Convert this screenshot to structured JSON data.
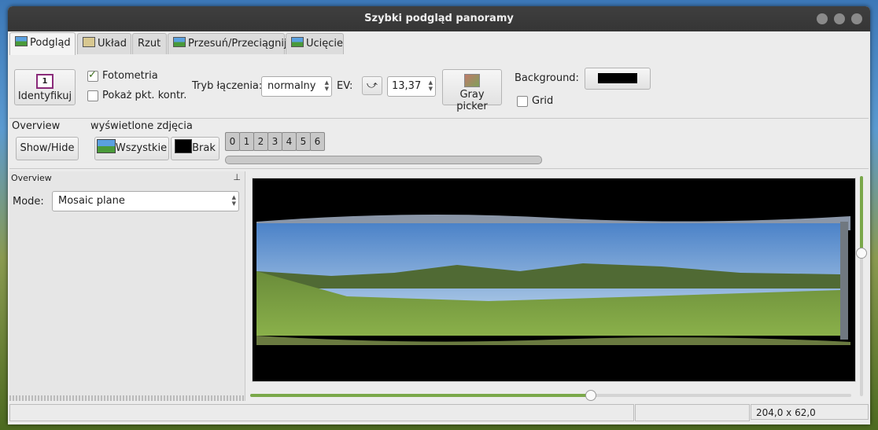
{
  "window": {
    "title": "Szybki podgląd panoramy"
  },
  "tabs": [
    {
      "label": "Podgląd",
      "icon": "preview-icon",
      "active": true
    },
    {
      "label": "Układ",
      "icon": "layout-icon"
    },
    {
      "label": "Rzut"
    },
    {
      "label": "Przesuń/Przeciągnij",
      "icon": "move-icon"
    },
    {
      "label": "Ucięcie",
      "icon": "crop-icon"
    }
  ],
  "toolbar": {
    "identify_label": "Identyfikuj",
    "photometric_label": "Fotometria",
    "photometric_checked": true,
    "show_cp_label": "Pokaż pkt. kontr.",
    "show_cp_checked": false,
    "blend_mode_label": "Tryb łączenia:",
    "blend_mode_value": "normalny",
    "ev_label": "EV:",
    "ev_value": "13,37",
    "gray_picker_label": "Gray picker",
    "background_label": "Background:",
    "background_color": "#000000",
    "grid_label": "Grid",
    "grid_checked": false
  },
  "overview_group": {
    "title": "Overview",
    "show_hide_label": "Show/Hide"
  },
  "images_group": {
    "title": "wyświetlone zdjęcia",
    "all_label": "Wszystkie",
    "none_label": "Brak",
    "images": [
      "0",
      "1",
      "2",
      "3",
      "4",
      "5",
      "6"
    ]
  },
  "overview_panel": {
    "title": "Overview",
    "mode_label": "Mode:",
    "mode_value": "Mosaic plane"
  },
  "statusbar": {
    "fov": "204,0 x 62,0"
  }
}
